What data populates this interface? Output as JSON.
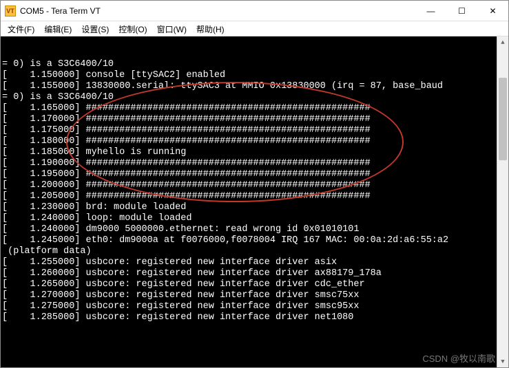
{
  "titlebar": {
    "icon_letters": "VT",
    "title": "COM5 - Tera Term VT"
  },
  "win_controls": {
    "minimize": "—",
    "maximize": "☐",
    "close": "✕"
  },
  "menu": {
    "file": "文件(F)",
    "edit": "编辑(E)",
    "setup": "设置(S)",
    "control": "控制(O)",
    "window": "窗口(W)",
    "help": "帮助(H)"
  },
  "terminal_lines": [
    "= 0) is a S3C6400/10",
    "[    1.150000] console [ttySAC2] enabled",
    "[    1.155000] 13830000.serial: ttySAC3 at MMIO 0x13830000 (irq = 87, base_baud",
    "= 0) is a S3C6400/10",
    "[    1.165000] ###################################################",
    "[    1.170000] ###################################################",
    "[    1.175000] ###################################################",
    "[    1.180000] ###################################################",
    "[    1.185000] myhello is running",
    "[    1.190000] ###################################################",
    "[    1.195000] ###################################################",
    "[    1.200000] ###################################################",
    "[    1.205000] ###################################################",
    "[    1.230000] brd: module loaded",
    "[    1.240000] loop: module loaded",
    "[    1.240000] dm9000 5000000.ethernet: read wrong id 0x01010101",
    "[    1.245000] eth0: dm9000a at f0076000,f0078004 IRQ 167 MAC: 00:0a:2d:a6:55:a2",
    " (platform data)",
    "[    1.255000] usbcore: registered new interface driver asix",
    "[    1.260000] usbcore: registered new interface driver ax88179_178a",
    "[    1.265000] usbcore: registered new interface driver cdc_ether",
    "[    1.270000] usbcore: registered new interface driver smsc75xx",
    "[    1.275000] usbcore: registered new interface driver smsc95xx",
    "[    1.285000] usbcore: registered new interface driver net1080"
  ],
  "scrollbar": {
    "up": "▲",
    "down": "▼"
  },
  "watermark": "CSDN @牧以南歌〆"
}
